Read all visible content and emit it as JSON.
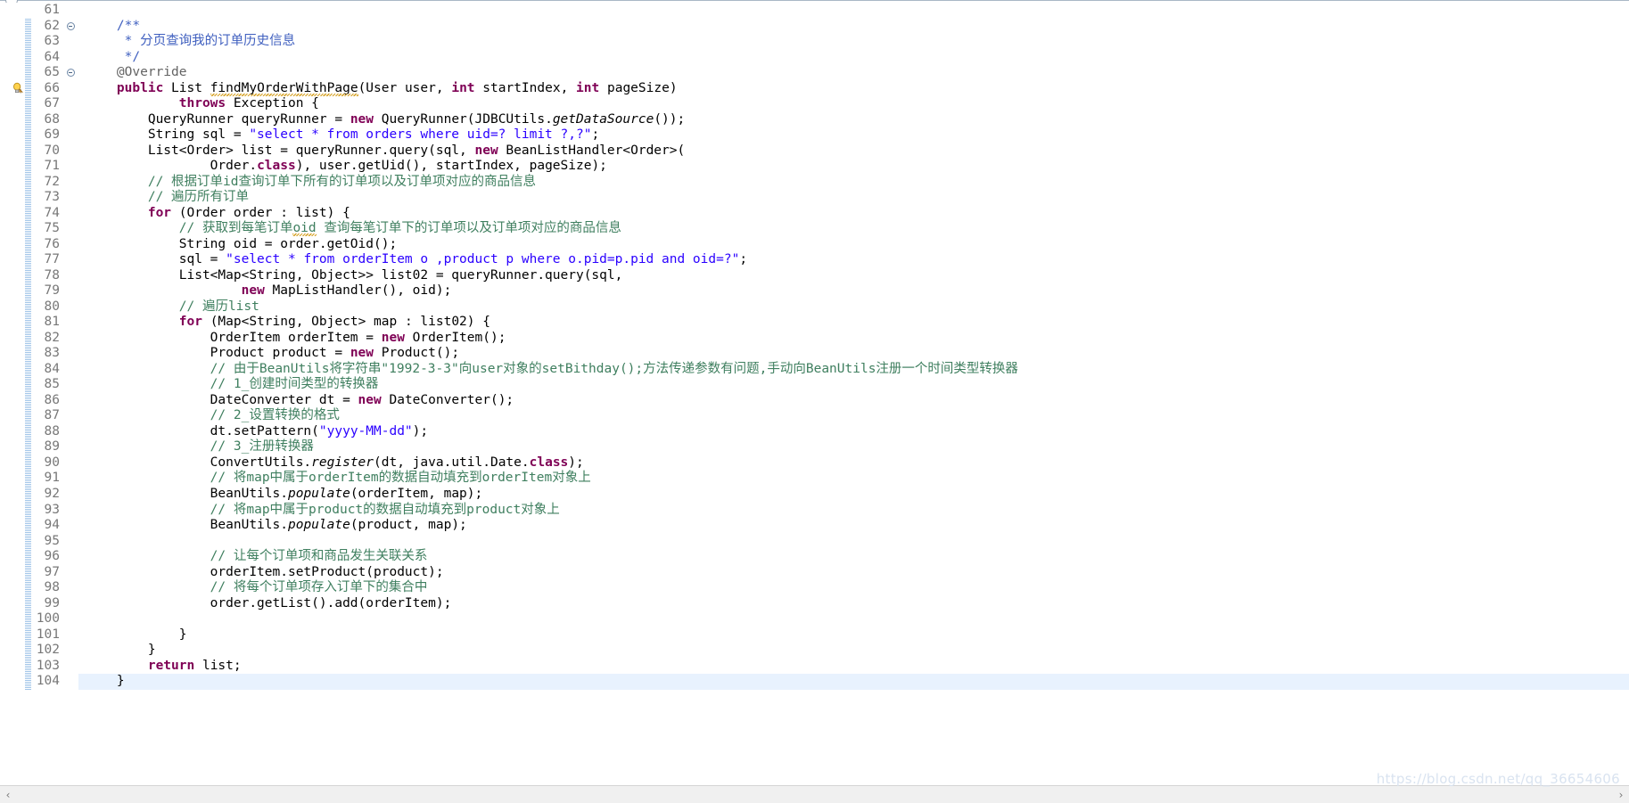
{
  "editor": {
    "name": "java-source-editor",
    "language": "Java",
    "first_line_number": 61,
    "last_line_number": 104,
    "current_line": 104,
    "colors": {
      "background": "#ffffff",
      "keyword": "#7f0055",
      "string": "#2a00ff",
      "comment": "#3f7f5f",
      "javadoc": "#3f5fbf",
      "annotation": "#646464",
      "field": "#0000c0",
      "line_number": "#787878",
      "current_line_highlight": "#e8f2fe",
      "quick_diff": "#9fc4e8",
      "watermark": "#d9e3f0"
    },
    "gutter": {
      "fold_markers": [
        62,
        65
      ],
      "warning_marker_line": 66,
      "warning_marker_icon": "warning-lightbulb-icon"
    },
    "lines": [
      {
        "n": 61,
        "indent": 0,
        "tokens": []
      },
      {
        "n": 62,
        "indent": 0,
        "tokens": [
          {
            "t": "jdoc",
            "v": "    /**"
          }
        ]
      },
      {
        "n": 63,
        "indent": 0,
        "tokens": [
          {
            "t": "jdoc",
            "v": "     * 分页查询我的订单历史信息"
          }
        ]
      },
      {
        "n": 64,
        "indent": 0,
        "tokens": [
          {
            "t": "jdoc",
            "v": "     */"
          }
        ]
      },
      {
        "n": 65,
        "indent": 0,
        "tokens": [
          {
            "t": "ann",
            "v": "    @Override"
          }
        ]
      },
      {
        "n": 66,
        "indent": 0,
        "tokens": [
          {
            "t": "plain",
            "v": "    "
          },
          {
            "t": "kw",
            "v": "public"
          },
          {
            "t": "plain",
            "v": " List "
          },
          {
            "t": "warn",
            "v": "findMyOrderWithPage"
          },
          {
            "t": "plain",
            "v": "(User user, "
          },
          {
            "t": "kw",
            "v": "int"
          },
          {
            "t": "plain",
            "v": " startIndex, "
          },
          {
            "t": "kw",
            "v": "int"
          },
          {
            "t": "plain",
            "v": " pageSize)"
          }
        ]
      },
      {
        "n": 67,
        "indent": 0,
        "tokens": [
          {
            "t": "plain",
            "v": "            "
          },
          {
            "t": "kw",
            "v": "throws"
          },
          {
            "t": "plain",
            "v": " Exception {"
          }
        ]
      },
      {
        "n": 68,
        "indent": 0,
        "tokens": [
          {
            "t": "plain",
            "v": "        QueryRunner queryRunner = "
          },
          {
            "t": "kw",
            "v": "new"
          },
          {
            "t": "plain",
            "v": " QueryRunner(JDBCUtils."
          },
          {
            "t": "stat",
            "v": "getDataSource"
          },
          {
            "t": "plain",
            "v": "());"
          }
        ]
      },
      {
        "n": 69,
        "indent": 0,
        "tokens": [
          {
            "t": "plain",
            "v": "        String sql = "
          },
          {
            "t": "str",
            "v": "\"select * from orders where uid=? limit ?,?\""
          },
          {
            "t": "plain",
            "v": ";"
          }
        ]
      },
      {
        "n": 70,
        "indent": 0,
        "tokens": [
          {
            "t": "plain",
            "v": "        List<Order> list = queryRunner.query(sql, "
          },
          {
            "t": "kw",
            "v": "new"
          },
          {
            "t": "plain",
            "v": " BeanListHandler<Order>("
          }
        ]
      },
      {
        "n": 71,
        "indent": 0,
        "tokens": [
          {
            "t": "plain",
            "v": "                Order."
          },
          {
            "t": "kw",
            "v": "class"
          },
          {
            "t": "plain",
            "v": "), user.getUid(), startIndex, pageSize);"
          }
        ]
      },
      {
        "n": 72,
        "indent": 0,
        "tokens": [
          {
            "t": "cmt",
            "v": "        // 根据订单id查询订单下所有的订单项以及订单项对应的商品信息"
          }
        ]
      },
      {
        "n": 73,
        "indent": 0,
        "tokens": [
          {
            "t": "cmt",
            "v": "        // 遍历所有订单"
          }
        ]
      },
      {
        "n": 74,
        "indent": 0,
        "tokens": [
          {
            "t": "plain",
            "v": "        "
          },
          {
            "t": "kw",
            "v": "for"
          },
          {
            "t": "plain",
            "v": " (Order order : list) {"
          }
        ]
      },
      {
        "n": 75,
        "indent": 0,
        "tokens": [
          {
            "t": "cmt",
            "v": "            // 获取到每笔订单"
          },
          {
            "t": "cmtwarn",
            "v": "oid"
          },
          {
            "t": "cmt",
            "v": " 查询每笔订单下的订单项以及订单项对应的商品信息"
          }
        ]
      },
      {
        "n": 76,
        "indent": 0,
        "tokens": [
          {
            "t": "plain",
            "v": "            String oid = order.getOid();"
          }
        ]
      },
      {
        "n": 77,
        "indent": 0,
        "tokens": [
          {
            "t": "plain",
            "v": "            sql = "
          },
          {
            "t": "str",
            "v": "\"select * from orderItem o ,product p where o.pid=p.pid and oid=?\""
          },
          {
            "t": "plain",
            "v": ";"
          }
        ]
      },
      {
        "n": 78,
        "indent": 0,
        "tokens": [
          {
            "t": "plain",
            "v": "            List<Map<String, Object>> list02 = queryRunner.query(sql,"
          }
        ]
      },
      {
        "n": 79,
        "indent": 0,
        "tokens": [
          {
            "t": "plain",
            "v": "                    "
          },
          {
            "t": "kw",
            "v": "new"
          },
          {
            "t": "plain",
            "v": " MapListHandler(), oid);"
          }
        ]
      },
      {
        "n": 80,
        "indent": 0,
        "tokens": [
          {
            "t": "cmt",
            "v": "            // 遍历list"
          }
        ]
      },
      {
        "n": 81,
        "indent": 0,
        "tokens": [
          {
            "t": "plain",
            "v": "            "
          },
          {
            "t": "kw",
            "v": "for"
          },
          {
            "t": "plain",
            "v": " (Map<String, Object> map : list02) {"
          }
        ]
      },
      {
        "n": 82,
        "indent": 0,
        "tokens": [
          {
            "t": "plain",
            "v": "                OrderItem orderItem = "
          },
          {
            "t": "kw",
            "v": "new"
          },
          {
            "t": "plain",
            "v": " OrderItem();"
          }
        ]
      },
      {
        "n": 83,
        "indent": 0,
        "tokens": [
          {
            "t": "plain",
            "v": "                Product product = "
          },
          {
            "t": "kw",
            "v": "new"
          },
          {
            "t": "plain",
            "v": " Product();"
          }
        ]
      },
      {
        "n": 84,
        "indent": 0,
        "tokens": [
          {
            "t": "cmt",
            "v": "                // 由于BeanUtils将字符串\"1992-3-3\"向user对象的setBithday();方法传递参数有问题,手动向BeanUtils注册一个时间类型转换器"
          }
        ]
      },
      {
        "n": 85,
        "indent": 0,
        "tokens": [
          {
            "t": "cmt",
            "v": "                // 1_创建时间类型的转换器"
          }
        ]
      },
      {
        "n": 86,
        "indent": 0,
        "tokens": [
          {
            "t": "plain",
            "v": "                DateConverter dt = "
          },
          {
            "t": "kw",
            "v": "new"
          },
          {
            "t": "plain",
            "v": " DateConverter();"
          }
        ]
      },
      {
        "n": 87,
        "indent": 0,
        "tokens": [
          {
            "t": "cmt",
            "v": "                // 2_设置转换的格式"
          }
        ]
      },
      {
        "n": 88,
        "indent": 0,
        "tokens": [
          {
            "t": "plain",
            "v": "                dt.setPattern("
          },
          {
            "t": "str",
            "v": "\"yyyy-MM-dd\""
          },
          {
            "t": "plain",
            "v": ");"
          }
        ]
      },
      {
        "n": 89,
        "indent": 0,
        "tokens": [
          {
            "t": "cmt",
            "v": "                // 3_注册转换器"
          }
        ]
      },
      {
        "n": 90,
        "indent": 0,
        "tokens": [
          {
            "t": "plain",
            "v": "                ConvertUtils."
          },
          {
            "t": "stat",
            "v": "register"
          },
          {
            "t": "plain",
            "v": "(dt, java.util.Date."
          },
          {
            "t": "kw",
            "v": "class"
          },
          {
            "t": "plain",
            "v": ");"
          }
        ]
      },
      {
        "n": 91,
        "indent": 0,
        "tokens": [
          {
            "t": "cmt",
            "v": "                // 将map中属于orderItem的数据自动填充到orderItem对象上"
          }
        ]
      },
      {
        "n": 92,
        "indent": 0,
        "tokens": [
          {
            "t": "plain",
            "v": "                BeanUtils."
          },
          {
            "t": "stat",
            "v": "populate"
          },
          {
            "t": "plain",
            "v": "(orderItem, map);"
          }
        ]
      },
      {
        "n": 93,
        "indent": 0,
        "tokens": [
          {
            "t": "cmt",
            "v": "                // 将map中属于product的数据自动填充到product对象上"
          }
        ]
      },
      {
        "n": 94,
        "indent": 0,
        "tokens": [
          {
            "t": "plain",
            "v": "                BeanUtils."
          },
          {
            "t": "stat",
            "v": "populate"
          },
          {
            "t": "plain",
            "v": "(product, map);"
          }
        ]
      },
      {
        "n": 95,
        "indent": 0,
        "tokens": []
      },
      {
        "n": 96,
        "indent": 0,
        "tokens": [
          {
            "t": "cmt",
            "v": "                // 让每个订单项和商品发生关联关系"
          }
        ]
      },
      {
        "n": 97,
        "indent": 0,
        "tokens": [
          {
            "t": "plain",
            "v": "                orderItem.setProduct(product);"
          }
        ]
      },
      {
        "n": 98,
        "indent": 0,
        "tokens": [
          {
            "t": "cmt",
            "v": "                // 将每个订单项存入订单下的集合中"
          }
        ]
      },
      {
        "n": 99,
        "indent": 0,
        "tokens": [
          {
            "t": "plain",
            "v": "                order.getList().add(orderItem);"
          }
        ]
      },
      {
        "n": 100,
        "indent": 0,
        "tokens": []
      },
      {
        "n": 101,
        "indent": 0,
        "tokens": [
          {
            "t": "plain",
            "v": "            }"
          }
        ]
      },
      {
        "n": 102,
        "indent": 0,
        "tokens": [
          {
            "t": "plain",
            "v": "        }"
          }
        ]
      },
      {
        "n": 103,
        "indent": 0,
        "tokens": [
          {
            "t": "plain",
            "v": "        "
          },
          {
            "t": "kw",
            "v": "return"
          },
          {
            "t": "plain",
            "v": " list;"
          }
        ]
      },
      {
        "n": 104,
        "indent": 0,
        "tokens": [
          {
            "t": "plain",
            "v": "    }"
          }
        ]
      }
    ]
  },
  "scrollbar": {
    "left_arrow": "‹",
    "right_arrow": "›"
  },
  "watermark": {
    "text": "https://blog.csdn.net/qq_36654606"
  }
}
